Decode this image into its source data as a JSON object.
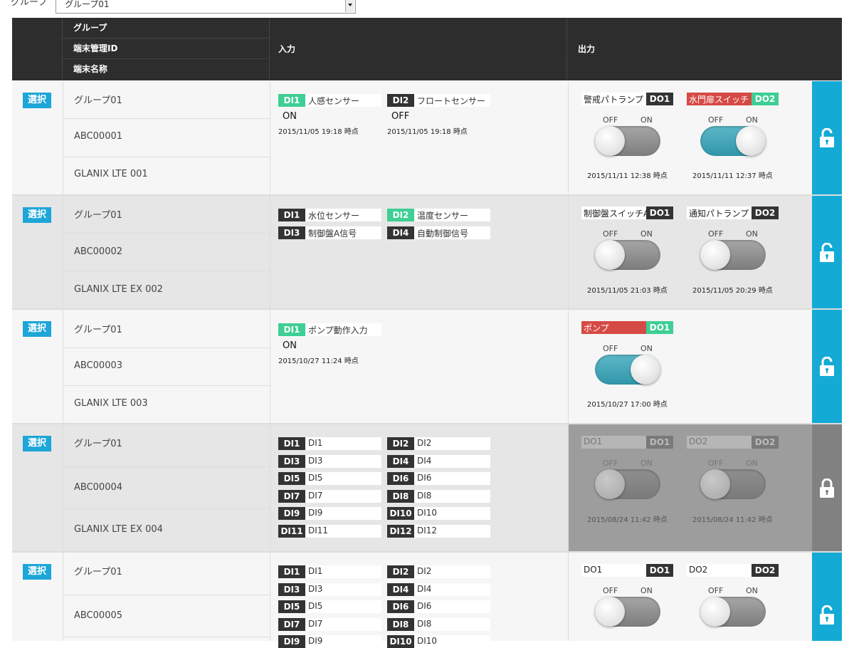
{
  "filter": {
    "label": "グループ",
    "selected": "グループ01"
  },
  "header": {
    "group": "グループ",
    "terminal_id": "端末管理ID",
    "terminal_name": "端末名称",
    "input": "入力",
    "output": "出力"
  },
  "select_label": "選択",
  "rows": [
    {
      "group": "グループ01",
      "id": "ABC00001",
      "name": "GLANIX LTE 001",
      "inputs": [
        {
          "tag": "DI1",
          "name": "人感センサー",
          "value": "ON",
          "ts": "2015/11/05 19:18 時点"
        },
        {
          "tag": "DI2",
          "name": "フロートセンサー",
          "value": "OFF",
          "ts": "2015/11/05 19:18 時点"
        }
      ],
      "outputs": [
        {
          "name": "警戒パトランプ",
          "tag": "DO1",
          "off": "OFF",
          "on": "ON",
          "ts": "2015/11/11 12:38 時点"
        },
        {
          "name": "水門扉スイッチ",
          "tag": "DO2",
          "off": "OFF",
          "on": "ON",
          "ts": "2015/11/11 12:37 時点"
        }
      ]
    },
    {
      "group": "グループ01",
      "id": "ABC00002",
      "name": "GLANIX LTE EX 002",
      "inputs": [
        {
          "tag": "DI1",
          "name": "水位センサー"
        },
        {
          "tag": "DI2",
          "name": "温度センサー"
        },
        {
          "tag": "DI3",
          "name": "制御盤A信号"
        },
        {
          "tag": "DI4",
          "name": "自動制御信号"
        }
      ],
      "outputs": [
        {
          "name": "制御盤スイッチA",
          "tag": "DO1",
          "off": "OFF",
          "on": "ON",
          "ts": "2015/11/05 21:03 時点"
        },
        {
          "name": "通知パトランプ",
          "tag": "DO2",
          "off": "OFF",
          "on": "ON",
          "ts": "2015/11/05 20:29 時点"
        }
      ]
    },
    {
      "group": "グループ01",
      "id": "ABC00003",
      "name": "GLANIX LTE 003",
      "inputs": [
        {
          "tag": "DI1",
          "name": "ポンプ動作入力",
          "value": "ON",
          "ts": "2015/10/27 11:24 時点"
        }
      ],
      "outputs": [
        {
          "name": "ポンプ",
          "tag": "DO1",
          "off": "OFF",
          "on": "ON",
          "ts": "2015/10/27 17:00 時点"
        }
      ]
    },
    {
      "group": "グループ01",
      "id": "ABC00004",
      "name": "GLANIX LTE EX 004",
      "inputs": [
        {
          "tag": "DI1",
          "name": "DI1"
        },
        {
          "tag": "DI2",
          "name": "DI2"
        },
        {
          "tag": "DI3",
          "name": "DI3"
        },
        {
          "tag": "DI4",
          "name": "DI4"
        },
        {
          "tag": "DI5",
          "name": "DI5"
        },
        {
          "tag": "DI6",
          "name": "DI6"
        },
        {
          "tag": "DI7",
          "name": "DI7"
        },
        {
          "tag": "DI8",
          "name": "DI8"
        },
        {
          "tag": "DI9",
          "name": "DI9"
        },
        {
          "tag": "DI10",
          "name": "DI10"
        },
        {
          "tag": "DI11",
          "name": "DI11"
        },
        {
          "tag": "DI12",
          "name": "DI12"
        }
      ],
      "outputs": [
        {
          "name": "DO1",
          "tag": "DO1",
          "off": "OFF",
          "on": "ON",
          "ts": "2015/08/24 11:42 時点"
        },
        {
          "name": "DO2",
          "tag": "DO2",
          "off": "OFF",
          "on": "ON",
          "ts": "2015/08/24 11:42 時点"
        }
      ]
    },
    {
      "group": "グループ01",
      "id": "ABC00005",
      "name": "",
      "inputs": [
        {
          "tag": "DI1",
          "name": "DI1"
        },
        {
          "tag": "DI2",
          "name": "DI2"
        },
        {
          "tag": "DI3",
          "name": "DI3"
        },
        {
          "tag": "DI4",
          "name": "DI4"
        },
        {
          "tag": "DI5",
          "name": "DI5"
        },
        {
          "tag": "DI6",
          "name": "DI6"
        },
        {
          "tag": "DI7",
          "name": "DI7"
        },
        {
          "tag": "DI8",
          "name": "DI8"
        },
        {
          "tag": "DI9",
          "name": "DI9"
        },
        {
          "tag": "DI10",
          "name": "DI10"
        }
      ],
      "outputs": [
        {
          "name": "DO1",
          "tag": "DO1",
          "off": "OFF",
          "on": "ON"
        },
        {
          "name": "DO2",
          "tag": "DO2",
          "off": "OFF",
          "on": "ON"
        }
      ]
    }
  ],
  "colors": {
    "accent": "#14aad6",
    "active_tag": "#3ecf94",
    "alert": "#d64a45",
    "header": "#2b2b2b"
  }
}
